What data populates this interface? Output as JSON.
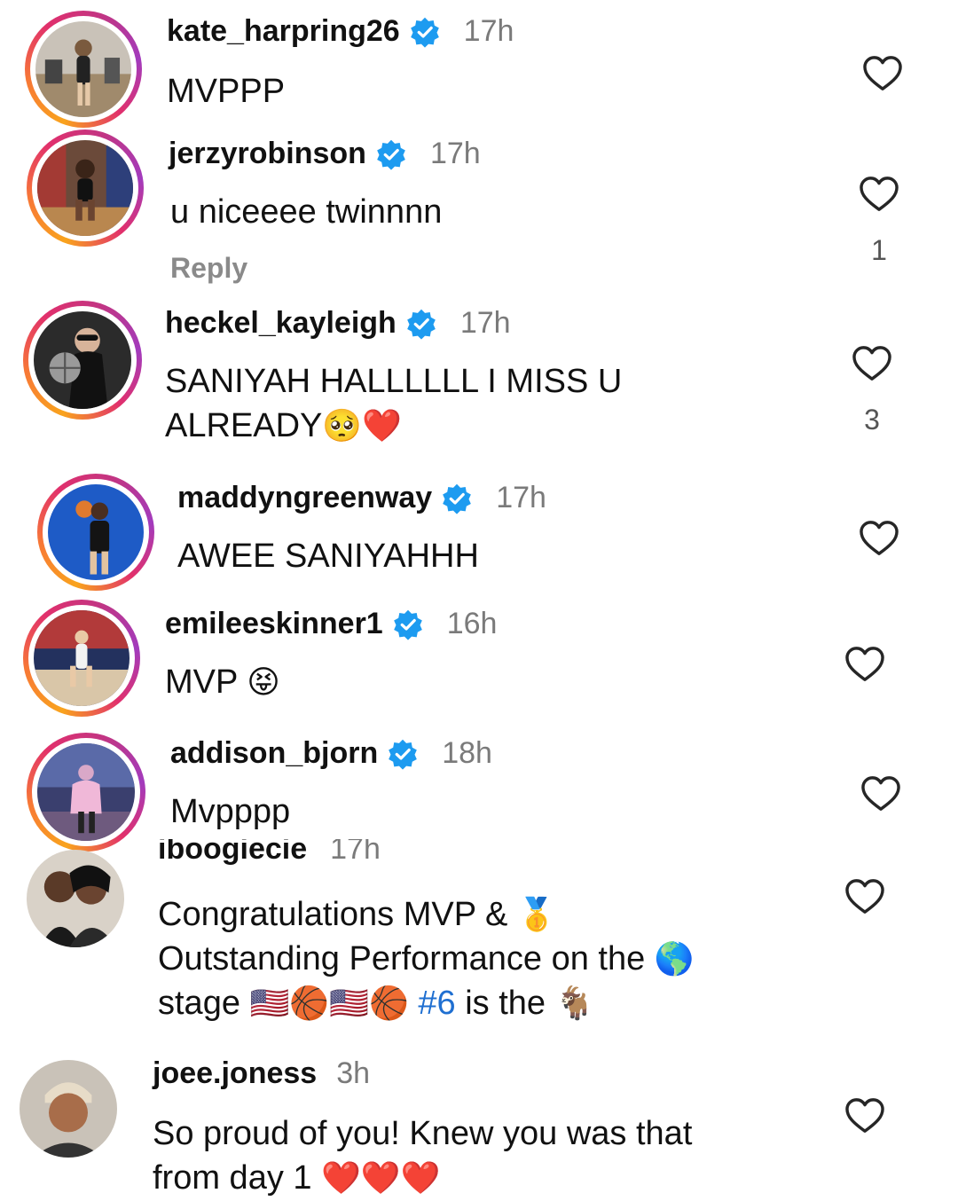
{
  "comments": [
    {
      "username": "kate_harpring26",
      "time": "17h",
      "text": "MVPPP",
      "verified": true
    },
    {
      "username": "jerzyrobinson",
      "time": "17h",
      "text": "u niceeee twinnnn",
      "verified": true,
      "reply": "Reply",
      "likes": "1"
    },
    {
      "username": "heckel_kayleigh",
      "time": "17h",
      "line1": "SANIYAH HALLLLLL I MISS U",
      "line2": "ALREADY",
      "emoji": "🥺❤️",
      "verified": true,
      "likes": "3"
    },
    {
      "username": "maddyngreenway",
      "time": "17h",
      "text": "AWEE SANIYAHHH",
      "verified": true
    },
    {
      "username": "emileeskinner1",
      "time": "16h",
      "text": "MVP",
      "emoji": "😝",
      "verified": true
    },
    {
      "username": "addison_bjorn",
      "time": "18h",
      "text": "Mvpppp",
      "verified": true
    },
    {
      "username": "iboogiecie",
      "time": "17h",
      "line1": "Congratulations MVP &",
      "line1_emoji": "🥇",
      "line2": "Outstanding Performance on the",
      "line2_emoji": "🌎",
      "line3_start": "stage",
      "line3_emoji": "🇺🇸🏀🇺🇸🏀",
      "hashtag": "#6",
      "line3_end": "is the",
      "line3_end_emoji": "🐐",
      "verified": false
    },
    {
      "username": "joee.joness",
      "time": "3h",
      "line1": "So proud of you! Knew you was that",
      "line2": "from day 1",
      "line2_emoji": "❤️❤️❤️",
      "verified": false
    }
  ],
  "icons": {
    "like": "heart-outline-icon",
    "verified": "verified-badge-icon"
  },
  "colors": {
    "verified": "#1d9bf0",
    "username": "#111111",
    "timestamp": "#7a7a7a",
    "hashtag": "#1f6fd1"
  }
}
